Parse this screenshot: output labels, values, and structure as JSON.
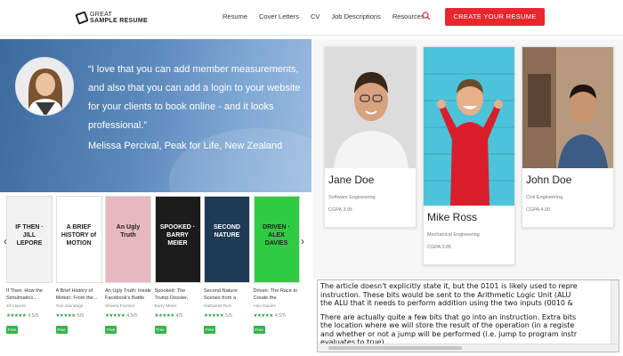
{
  "header": {
    "logo_line1": "GREAT",
    "logo_line2": "SAMPLE RESUME",
    "nav": [
      "Resume",
      "Cover Letters",
      "CV",
      "Job Descriptions",
      "Resources"
    ],
    "cta_label": "CREATE YOUR RESUME"
  },
  "testimonial": {
    "quote": "“I love that you can add member measurements, and also that you can add a login to your website for your clients to book online - and it looks professional.”",
    "author": "Melissa Percival, Peak for Life, New Zealand"
  },
  "books": [
    {
      "title": "If Then: How the Simulmatics...",
      "author": "Jill Lepore",
      "rating_count": "4.5/5",
      "badge": "Free",
      "cover_bg": "#f2f2f2",
      "cover_text": "IF THEN · JILL LEPORE"
    },
    {
      "title": "A Brief History of Motion: From the...",
      "author": "Tom Standage",
      "rating_count": "5/5",
      "badge": "Free",
      "cover_bg": "#ffffff",
      "cover_text": "A BRIEF HISTORY of MOTION"
    },
    {
      "title": "An Ugly Truth: Inside Facebook's Battle for...",
      "author": "Sheera Frenkel",
      "rating_count": "4.5/5",
      "badge": "Free",
      "cover_bg": "#e8b8c0",
      "cover_text": "An Ugly Truth"
    },
    {
      "title": "Spooked: The Trump Dossier, Black Cube,...",
      "author": "Barry Meier",
      "rating_count": "4/5",
      "badge": "Free",
      "cover_bg": "#1c1c1c",
      "cover_text": "SPOOKED · BARRY MEIER"
    },
    {
      "title": "Second Nature: Scenes from a World Remade",
      "author": "Nathaniel Rich",
      "rating_count": "5/5",
      "badge": "Free",
      "cover_bg": "#1f3a55",
      "cover_text": "SECOND NATURE"
    },
    {
      "title": "Driven: The Race to Create the Autonomo...",
      "author": "Alex Davies",
      "rating_count": "4.5/5",
      "badge": "Free",
      "cover_bg": "#2ecc40",
      "cover_text": "DRIVEN · ALEX DAVIES"
    }
  ],
  "profiles": [
    {
      "name": "Jane Doe",
      "role": "Software Engineering",
      "gpa": "CGPA 3.95"
    },
    {
      "name": "Mike Ross",
      "role": "Mechanical Engineering",
      "gpa": "CGPA 3.85"
    },
    {
      "name": "John Doe",
      "role": "Civil Engineering",
      "gpa": "CGPA 4.00"
    }
  ],
  "article": {
    "line1": "The article doesn't explicitly state it, but the 0101 is likely used to repre",
    "line2": "instruction. These bits would be sent to the Arithmetic Logic Unit (ALU ",
    "line3": "the ALU that it needs to perform addition using the two inputs (0010 &",
    "line4": "There are actually quite a few bits that go into an instruction. Extra bits",
    "line5": "the location where we will store the result of the operation (in a registe",
    "line6": "and whether or not a jump will be performed (i.e. jump to program instr",
    "line7": "evaluates to true)."
  },
  "colors": {
    "accent": "#e8262f",
    "free_badge": "#38b44a"
  },
  "icons": [
    "search-icon",
    "chevron-left-icon",
    "chevron-right-icon"
  ]
}
